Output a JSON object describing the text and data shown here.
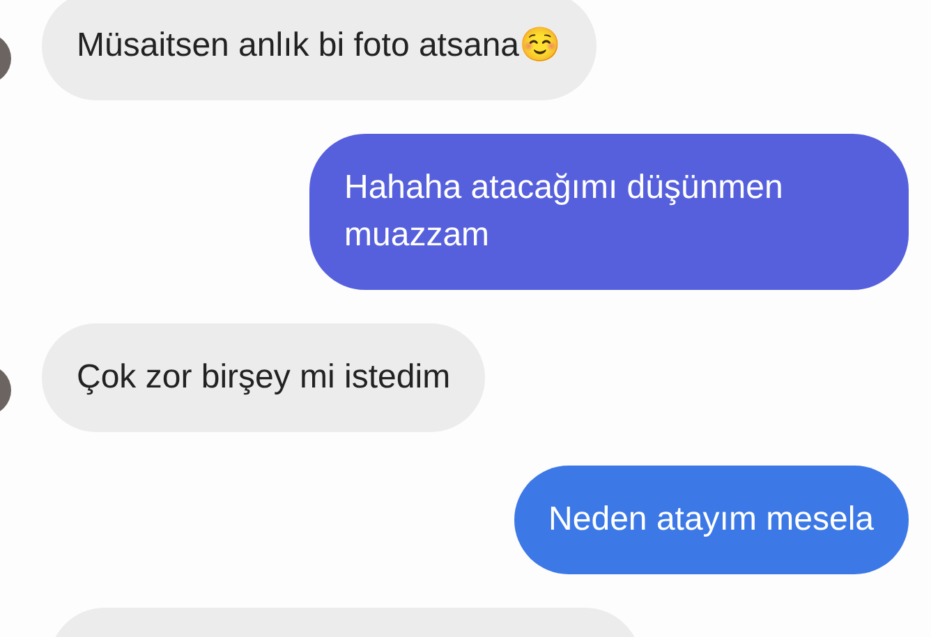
{
  "messages": [
    {
      "kind": "incoming",
      "avatar": true,
      "text": "Müsaitsen anlık bi foto atsana☺️"
    },
    {
      "kind": "outgoing",
      "color": "#5660dc",
      "text": "Hahaha atacağımı düşünmen muazzam"
    },
    {
      "kind": "incoming",
      "avatar": true,
      "text": "Çok zor birşey mi istedim"
    },
    {
      "kind": "outgoing",
      "color": "#3c79e6",
      "text": "Neden atayım mesela"
    },
    {
      "kind": "incoming",
      "avatar": false
    }
  ]
}
